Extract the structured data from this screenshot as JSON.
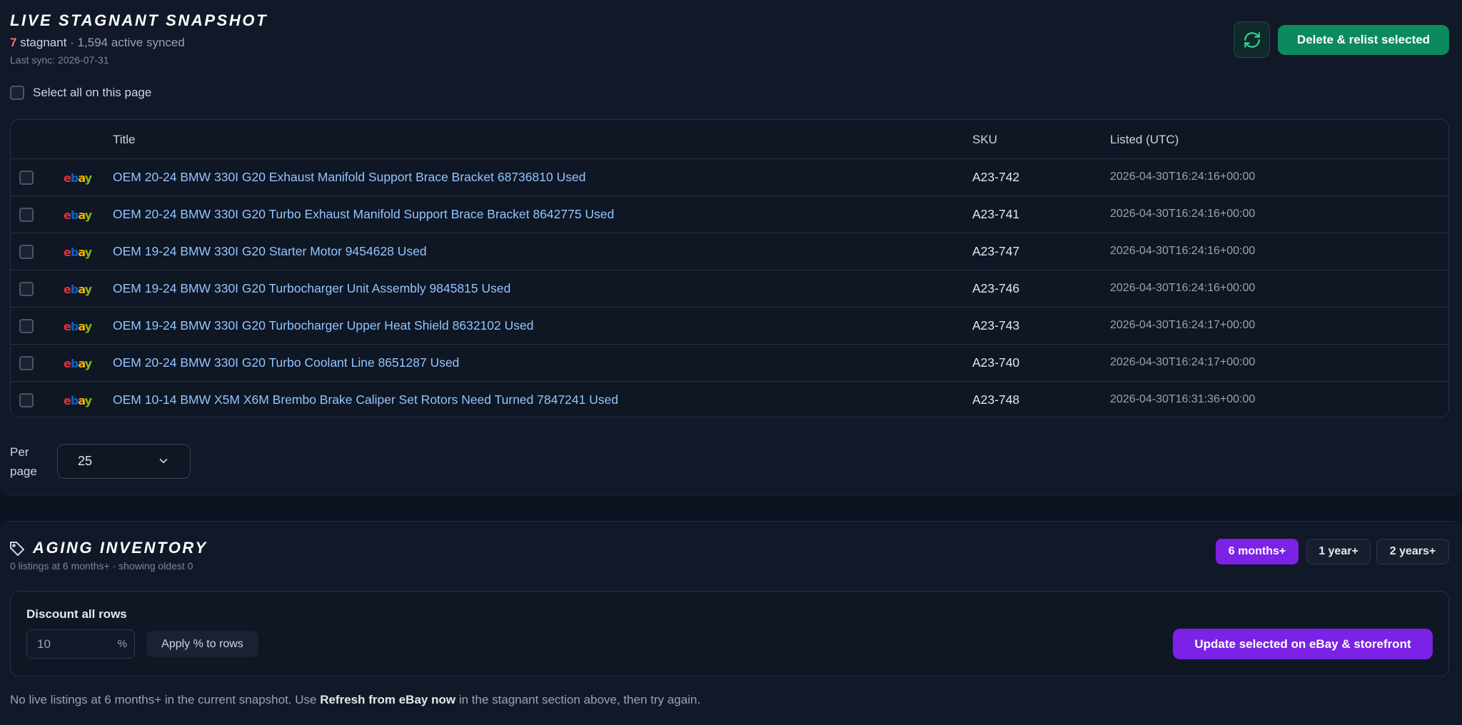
{
  "stagnant": {
    "title": "LIVE STAGNANT SNAPSHOT",
    "stagnant_count": "7",
    "stagnant_word": "stagnant",
    "active_synced": "· 1,594 active synced",
    "last_sync": "Last sync: 2026-07-31",
    "relist_label": "Delete & relist selected",
    "refresh_icon": "refresh-icon",
    "select_all_label": "Select all on this page",
    "columns": {
      "title": "Title",
      "sku": "SKU",
      "listed": "Listed (UTC)"
    },
    "rows": [
      {
        "marketplace": "ebay",
        "title": "OEM 20-24 BMW 330I G20 Exhaust Manifold Support Brace Bracket 68736810 Used",
        "sku": "A23-742",
        "listed": "2026-04-30T16:24:16+00:00"
      },
      {
        "marketplace": "ebay",
        "title": "OEM 20-24 BMW 330I G20 Turbo Exhaust Manifold Support Brace Bracket 8642775 Used",
        "sku": "A23-741",
        "listed": "2026-04-30T16:24:16+00:00"
      },
      {
        "marketplace": "ebay",
        "title": "OEM 19-24 BMW 330I G20 Starter Motor 9454628 Used",
        "sku": "A23-747",
        "listed": "2026-04-30T16:24:16+00:00"
      },
      {
        "marketplace": "ebay",
        "title": "OEM 19-24 BMW 330I G20 Turbocharger Unit Assembly 9845815 Used",
        "sku": "A23-746",
        "listed": "2026-04-30T16:24:16+00:00"
      },
      {
        "marketplace": "ebay",
        "title": "OEM 19-24 BMW 330I G20 Turbocharger Upper Heat Shield 8632102 Used",
        "sku": "A23-743",
        "listed": "2026-04-30T16:24:17+00:00"
      },
      {
        "marketplace": "ebay",
        "title": "OEM 20-24 BMW 330I G20 Turbo Coolant Line 8651287 Used",
        "sku": "A23-740",
        "listed": "2026-04-30T16:24:17+00:00"
      },
      {
        "marketplace": "ebay",
        "title": "OEM 10-14 BMW X5M X6M Brembo Brake Caliper Set Rotors Need Turned 7847241 Used",
        "sku": "A23-748",
        "listed": "2026-04-30T16:31:36+00:00"
      }
    ],
    "per_page_label_1": "Per",
    "per_page_label_2": "page",
    "per_page_value": "25"
  },
  "aging": {
    "title": "AGING INVENTORY",
    "tag_icon": "tag-icon",
    "subtitle": "0 listings at 6 months+ · showing oldest 0",
    "filters": [
      {
        "label": "6 months+",
        "active": true
      },
      {
        "label": "1 year+",
        "active": false
      },
      {
        "label": "2 years+",
        "active": false
      }
    ],
    "discount_label": "Discount all rows",
    "discount_value": "10",
    "percent_sign": "%",
    "apply_label": "Apply % to rows",
    "update_label": "Update selected on eBay & storefront",
    "empty_msg_1": "No live listings at 6 months+ in the current snapshot. Use",
    "empty_msg_bold": "Refresh from eBay now",
    "empty_msg_2": "in the stagnant section above, then try again."
  },
  "colors": {
    "background": "#0d1320",
    "accent_green": "#0c8a5f",
    "accent_purple": "#7c22e6",
    "link_blue": "#93c5fd",
    "stagnant_red": "#f87171"
  }
}
